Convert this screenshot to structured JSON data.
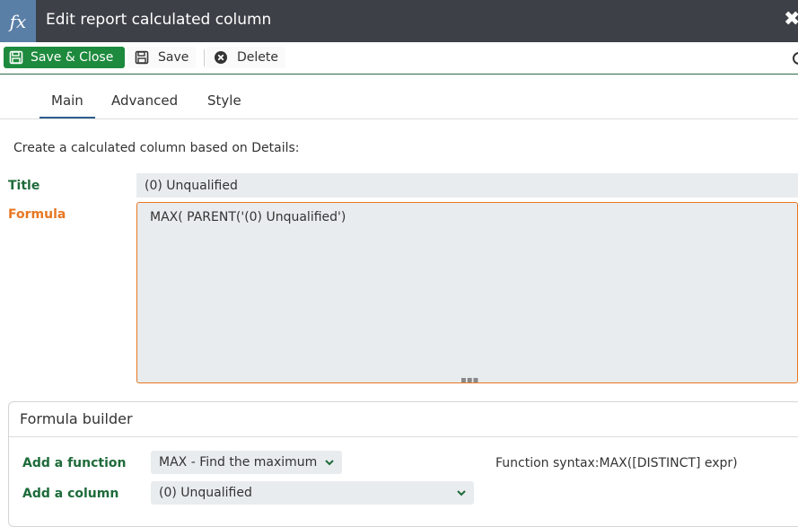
{
  "window": {
    "title": "Edit report calculated column",
    "fx_icon_text": "fx"
  },
  "toolbar": {
    "save_close_label": "Save & Close",
    "save_label": "Save",
    "delete_label": "Delete"
  },
  "tabs": [
    {
      "label": "Main",
      "active": true
    },
    {
      "label": "Advanced",
      "active": false
    },
    {
      "label": "Style",
      "active": false
    }
  ],
  "main": {
    "description": "Create a calculated column based on Details:",
    "title_label": "Title",
    "title_value": "(0) Unqualified",
    "formula_label": "Formula",
    "formula_value": "MAX( PARENT('(0) Unqualified')"
  },
  "builder": {
    "heading": "Formula builder",
    "function_label": "Add a function",
    "function_value": "MAX - Find the maximum",
    "column_label": "Add a column",
    "column_value": "(0) Unqualified",
    "syntax_text": "Function syntax:MAX([DISTINCT] expr)"
  },
  "colors": {
    "titlebar": "#3d4147",
    "fx_box": "#5a7fa6",
    "primary_button": "#1d8a3d",
    "label_green": "#1e6b3a",
    "label_orange": "#e87722",
    "tab_underline": "#2b5f8f"
  }
}
